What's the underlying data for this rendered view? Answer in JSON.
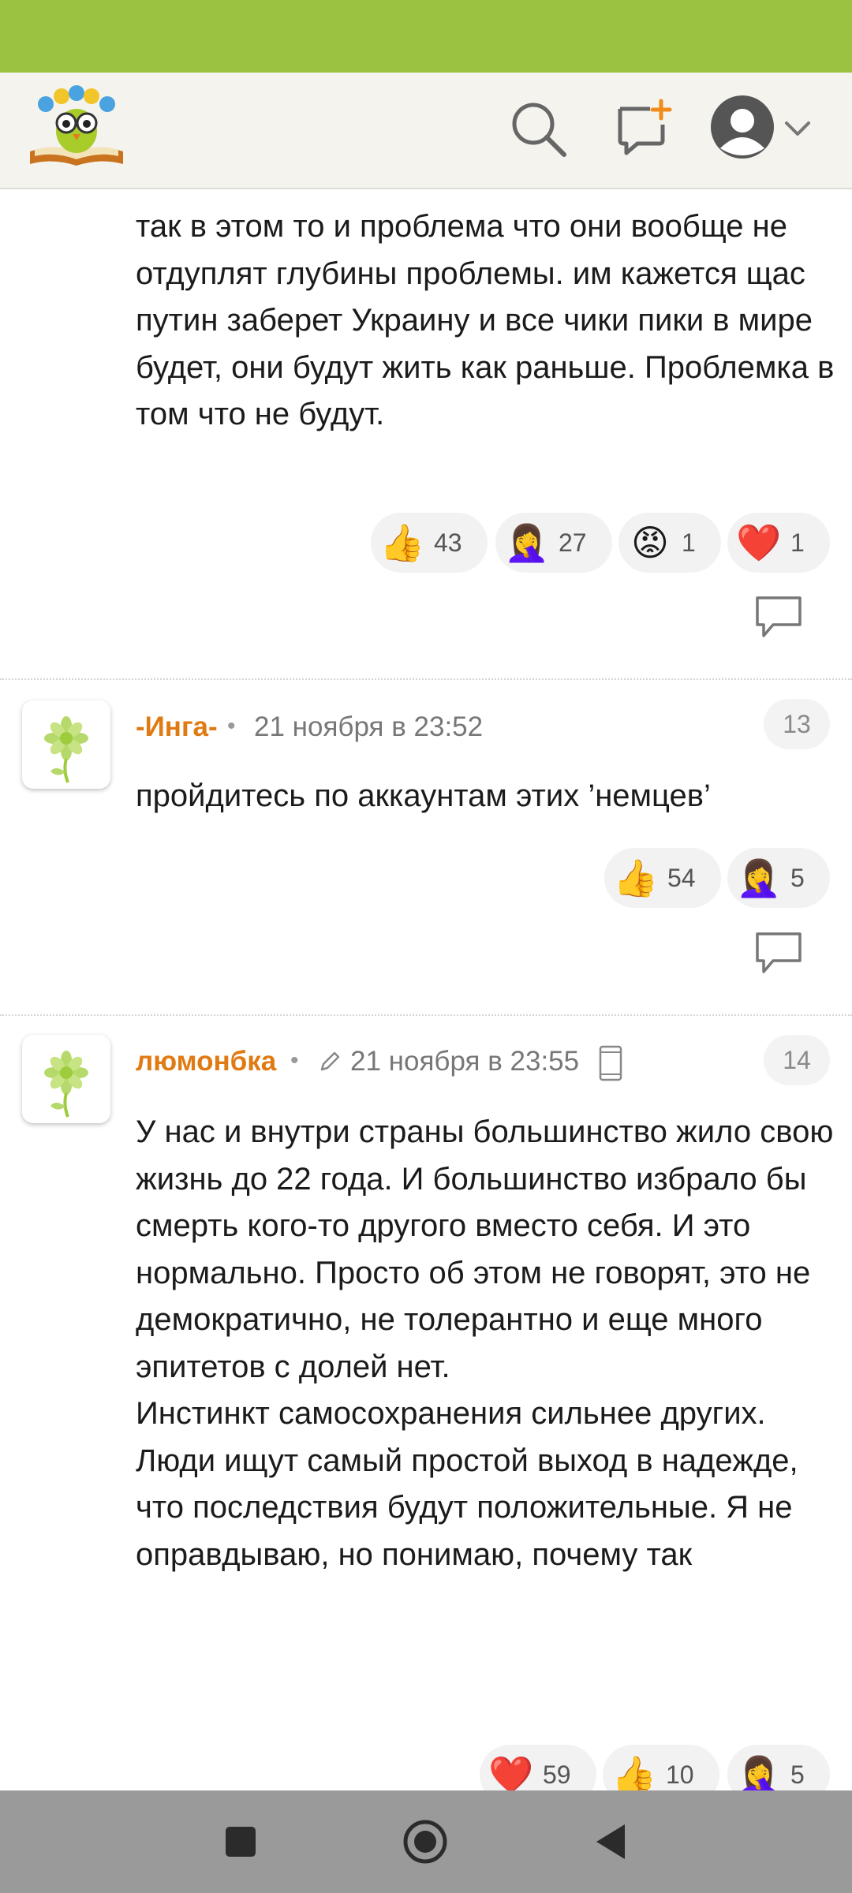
{
  "header": {
    "logo_icon": "owl-on-book-logo",
    "search_icon": "search-icon",
    "add_post_icon": "add-post-icon",
    "avatar_icon": "user-avatar-icon",
    "menu_icon": "chevron-down-icon"
  },
  "comments": [
    {
      "text": "так в этом то и проблема что они вообще не отдуплят глубины проблемы. им кажется щас путин заберет Украину и все чики пики в мире будет, они будут жить как раньше. Проблемка в том что не будут.",
      "reactions": [
        {
          "emoji": "👍",
          "count": "43"
        },
        {
          "emoji": "🤦‍♀️",
          "count": "27"
        },
        {
          "emoji": "😡",
          "count": "1"
        },
        {
          "emoji": "❤️",
          "count": "1"
        }
      ]
    },
    {
      "author": "-Инга-",
      "separator": "•",
      "date": "21 ноября в 23:52",
      "number": "13",
      "text": "пройдитесь по аккаунтам этих ’немцев’",
      "reactions": [
        {
          "emoji": "👍",
          "count": "54"
        },
        {
          "emoji": "🤦‍♀️",
          "count": "5"
        }
      ]
    },
    {
      "author": "люмонбка",
      "separator": "•",
      "date": "21 ноября в 23:55",
      "number": "14",
      "paragraphs": [
        "У нас и внутри страны большинство жило свою жизнь до 22 года. И большинство избрало бы смерть кого-то другого вместо себя. И это нормально. Просто об этом не говорят, это не демократично, не толерантно и еще много эпитетов с долей нет.",
        "Инстинкт самосохранения сильнее других.",
        "Люди ищут самый простой выход в надежде, что последствия будут положительные. Я не оправдываю, но понимаю, почему так"
      ],
      "reactions": [
        {
          "emoji": "❤️",
          "count": "59"
        },
        {
          "emoji": "👍",
          "count": "10"
        },
        {
          "emoji": "🤦‍♀️",
          "count": "5"
        }
      ]
    }
  ],
  "colors": {
    "status_bar": "#9cc241",
    "author": "#e07a12",
    "nav_bar": "#9a9a9a"
  }
}
